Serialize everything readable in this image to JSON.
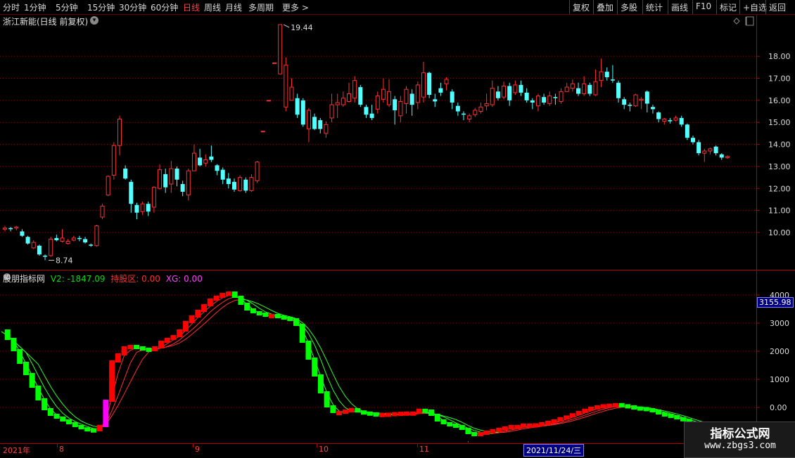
{
  "toolbar": {
    "periods": [
      "分时",
      "1分钟",
      "5分钟",
      "15分钟",
      "30分钟",
      "60分钟",
      "日线",
      "周线",
      "月线",
      "多周期",
      "更多 >"
    ],
    "active_period": "日线",
    "right_buttons": [
      "复权",
      "叠加",
      "多股",
      "统计",
      "画线",
      "F10",
      "标记",
      "+自选",
      "返回"
    ]
  },
  "main_chart": {
    "title": "浙江新能(日线 前复权)",
    "high_label": "19.44",
    "low_label": "8.74",
    "y_ticks": [
      "18.00",
      "17.00",
      "16.00",
      "15.00",
      "14.00",
      "13.00",
      "12.00",
      "11.00",
      "10.00"
    ]
  },
  "indicator": {
    "name": "股朋指标网",
    "v2_text": "V2: -1847.09",
    "hold_text": "持股区: 0.00",
    "xg_text": "XG: 0.00",
    "current_value": "3155.98",
    "y_ticks": [
      "4000",
      "3000",
      "2000",
      "1000",
      "0.00"
    ]
  },
  "date_axis": {
    "labels": [
      "2021年",
      "8",
      "9",
      "10",
      "11"
    ],
    "cursor_date": "2021/11/24/三"
  },
  "watermark": {
    "title": "指标公式网",
    "url": "www.zbgs3.com"
  },
  "colors": {
    "up": "#ff3030",
    "down": "#54ffff",
    "grid": "#8b0000",
    "bull_block": "#ff0000",
    "bear_block": "#00ff00",
    "signal_block": "#ff00ff"
  },
  "chart_data": {
    "type": "candlestick",
    "title": "浙江新能(日线 前复权)",
    "ylim": [
      8.5,
      19.6
    ],
    "candles": [
      [
        10.15,
        10.2,
        10.3,
        10.05
      ],
      [
        10.2,
        10.15,
        10.25,
        10.05
      ],
      [
        10.2,
        10.25,
        10.3,
        10.1
      ],
      [
        10.05,
        9.85,
        10.15,
        9.8
      ],
      [
        9.8,
        9.5,
        9.85,
        9.45
      ],
      [
        9.3,
        9.55,
        9.65,
        9.25
      ],
      [
        9.4,
        9.0,
        9.45,
        8.95
      ],
      [
        8.95,
        8.9,
        9.0,
        8.74
      ],
      [
        8.95,
        9.7,
        9.8,
        8.9
      ],
      [
        9.75,
        9.65,
        9.9,
        9.6
      ],
      [
        9.6,
        9.75,
        10.15,
        9.55
      ],
      [
        9.5,
        9.6,
        9.7,
        9.45
      ],
      [
        9.65,
        9.75,
        9.85,
        9.6
      ],
      [
        9.75,
        9.7,
        9.85,
        9.6
      ],
      [
        9.7,
        9.55,
        9.8,
        9.5
      ],
      [
        9.45,
        9.4,
        9.5,
        9.35
      ],
      [
        9.4,
        10.3,
        10.35,
        9.35
      ],
      [
        10.7,
        11.2,
        11.3,
        10.6
      ],
      [
        11.7,
        12.55,
        12.6,
        11.65
      ],
      [
        12.6,
        13.95,
        14.1,
        12.4
      ],
      [
        13.95,
        15.15,
        15.3,
        13.5
      ],
      [
        12.9,
        12.45,
        13.05,
        12.4
      ],
      [
        12.3,
        11.3,
        12.4,
        10.9
      ],
      [
        11.25,
        10.9,
        11.35,
        10.6
      ],
      [
        10.95,
        11.3,
        11.4,
        10.8
      ],
      [
        11.3,
        10.95,
        11.4,
        10.75
      ],
      [
        11.15,
        12.05,
        12.1,
        10.9
      ],
      [
        12.0,
        12.85,
        13.1,
        11.95
      ],
      [
        12.65,
        12.05,
        12.9,
        11.8
      ],
      [
        12.2,
        12.9,
        13.25,
        11.8
      ],
      [
        12.9,
        12.4,
        13.0,
        12.1
      ],
      [
        12.2,
        11.85,
        12.35,
        11.65
      ],
      [
        11.7,
        12.8,
        12.9,
        11.45
      ],
      [
        12.8,
        13.6,
        14.0,
        12.8
      ],
      [
        13.4,
        13.05,
        13.8,
        13.0
      ],
      [
        13.15,
        13.3,
        13.55,
        13.0
      ],
      [
        13.45,
        13.3,
        13.95,
        13.2
      ],
      [
        13.05,
        12.8,
        13.1,
        12.6
      ],
      [
        12.85,
        12.4,
        12.95,
        12.2
      ],
      [
        12.45,
        12.2,
        12.7,
        12.0
      ],
      [
        12.3,
        11.95,
        12.45,
        11.85
      ],
      [
        11.9,
        12.5,
        12.6,
        11.85
      ],
      [
        12.4,
        11.9,
        12.5,
        11.8
      ],
      [
        11.9,
        12.5,
        12.65,
        11.85
      ],
      [
        12.35,
        13.2,
        13.25,
        12.25
      ],
      [
        14.6,
        14.6,
        14.6,
        14.6
      ],
      [
        16.0,
        16.0,
        16.0,
        16.0
      ],
      [
        17.7,
        17.7,
        17.7,
        17.7
      ],
      [
        17.2,
        19.44,
        19.44,
        17.2
      ],
      [
        15.7,
        17.6,
        17.95,
        15.5
      ],
      [
        16.0,
        16.6,
        17.0,
        16.0
      ],
      [
        16.1,
        15.35,
        16.3,
        15.2
      ],
      [
        16.0,
        14.9,
        16.1,
        14.8
      ],
      [
        14.7,
        15.55,
        15.65,
        14.1
      ],
      [
        15.25,
        14.7,
        15.4,
        14.65
      ],
      [
        15.1,
        14.7,
        15.2,
        14.5
      ],
      [
        14.5,
        14.9,
        15.05,
        14.3
      ],
      [
        15.2,
        15.8,
        16.3,
        15.0
      ],
      [
        15.8,
        15.9,
        16.3,
        15.2
      ],
      [
        15.8,
        16.1,
        16.4,
        15.7
      ],
      [
        15.95,
        16.3,
        16.8,
        15.9
      ],
      [
        16.1,
        16.9,
        17.1,
        15.9
      ],
      [
        16.6,
        15.8,
        16.7,
        15.7
      ],
      [
        15.7,
        15.35,
        15.8,
        15.2
      ],
      [
        15.4,
        15.2,
        15.8,
        15.1
      ],
      [
        15.6,
        16.2,
        16.4,
        15.4
      ],
      [
        16.05,
        16.5,
        17.0,
        15.9
      ],
      [
        15.8,
        16.4,
        16.95,
        15.7
      ],
      [
        16.05,
        15.55,
        16.2,
        14.9
      ],
      [
        15.3,
        15.95,
        16.2,
        15.0
      ],
      [
        15.85,
        16.5,
        16.65,
        15.4
      ],
      [
        16.3,
        15.8,
        16.5,
        15.3
      ],
      [
        15.9,
        16.7,
        16.85,
        15.6
      ],
      [
        16.15,
        17.25,
        17.75,
        15.9
      ],
      [
        17.25,
        16.25,
        17.3,
        16.1
      ],
      [
        16.05,
        15.95,
        16.3,
        15.7
      ],
      [
        16.55,
        16.35,
        16.8,
        16.2
      ],
      [
        16.75,
        16.95,
        17.05,
        16.45
      ],
      [
        16.4,
        15.9,
        16.5,
        15.6
      ],
      [
        15.75,
        15.5,
        15.9,
        15.3
      ],
      [
        15.4,
        15.35,
        15.5,
        15.1
      ],
      [
        15.15,
        15.3,
        15.4,
        15.0
      ],
      [
        15.35,
        15.55,
        15.65,
        15.25
      ],
      [
        15.5,
        15.7,
        15.9,
        15.4
      ],
      [
        15.75,
        15.85,
        16.3,
        15.55
      ],
      [
        15.8,
        16.55,
        16.9,
        15.7
      ],
      [
        16.4,
        16.1,
        16.65,
        16.0
      ],
      [
        16.15,
        16.65,
        16.85,
        16.05
      ],
      [
        16.65,
        16.0,
        16.8,
        15.75
      ],
      [
        16.35,
        16.7,
        16.9,
        16.25
      ],
      [
        16.7,
        16.35,
        16.9,
        16.2
      ],
      [
        16.35,
        16.0,
        16.55,
        15.9
      ],
      [
        16.0,
        15.9,
        16.1,
        15.6
      ],
      [
        15.75,
        16.2,
        16.3,
        15.5
      ],
      [
        16.15,
        15.9,
        16.3,
        15.8
      ],
      [
        15.85,
        16.2,
        16.4,
        15.75
      ],
      [
        16.15,
        16.1,
        16.3,
        15.8
      ],
      [
        15.95,
        16.4,
        16.55,
        15.85
      ],
      [
        16.4,
        16.6,
        16.8,
        16.4
      ],
      [
        16.55,
        16.75,
        16.95,
        16.4
      ],
      [
        16.55,
        16.3,
        16.8,
        16.2
      ],
      [
        16.3,
        16.75,
        17.1,
        16.2
      ],
      [
        16.7,
        16.3,
        16.8,
        16.2
      ],
      [
        16.25,
        16.85,
        17.4,
        16.2
      ],
      [
        16.9,
        17.3,
        17.9,
        16.6
      ],
      [
        17.3,
        17.05,
        17.5,
        16.9
      ],
      [
        16.95,
        16.9,
        17.6,
        16.8
      ],
      [
        16.8,
        16.1,
        16.9,
        15.9
      ],
      [
        16.05,
        15.8,
        16.15,
        15.6
      ],
      [
        15.8,
        15.75,
        15.9,
        15.5
      ],
      [
        15.75,
        16.25,
        16.3,
        15.7
      ],
      [
        16.0,
        16.05,
        16.15,
        15.6
      ],
      [
        16.4,
        15.85,
        16.45,
        15.45
      ],
      [
        15.7,
        15.6,
        15.8,
        15.4
      ],
      [
        15.45,
        15.15,
        15.5,
        15.0
      ],
      [
        15.05,
        15.15,
        15.2,
        14.9
      ],
      [
        15.1,
        15.05,
        15.2,
        14.95
      ],
      [
        15.1,
        15.2,
        15.3,
        15.05
      ],
      [
        15.2,
        14.9,
        15.3,
        14.8
      ],
      [
        14.9,
        14.3,
        14.95,
        14.2
      ],
      [
        14.3,
        14.1,
        14.4,
        14.0
      ],
      [
        14.1,
        13.6,
        14.2,
        13.5
      ],
      [
        13.6,
        13.7,
        13.8,
        13.2
      ],
      [
        13.7,
        13.8,
        13.85,
        13.55
      ],
      [
        13.9,
        13.6,
        13.95,
        13.5
      ],
      [
        13.55,
        13.4,
        13.6,
        13.3
      ],
      [
        13.4,
        13.45,
        13.5,
        13.35
      ]
    ]
  },
  "indicator_data": {
    "ylim": [
      -1200,
      4500
    ],
    "values": [
      2700,
      2400,
      2000,
      1550,
      1150,
      700,
      250,
      -100,
      -300,
      -400,
      -500,
      -600,
      -700,
      -780,
      -820,
      -850,
      -700,
      200,
      1600,
      1850,
      2100,
      2150,
      2100,
      2050,
      2000,
      2100,
      2300,
      2400,
      2500,
      2700,
      3000,
      3200,
      3400,
      3600,
      3800,
      3900,
      4000,
      4050,
      3900,
      3650,
      3450,
      3350,
      3300,
      3250,
      3250,
      3200,
      3150,
      3100,
      2900,
      2300,
      1700,
      1100,
      500,
      0,
      -200,
      -200,
      -150,
      -100,
      -180,
      -220,
      -250,
      -280,
      -270,
      -260,
      -240,
      -230,
      -220,
      -220,
      -120,
      -150,
      -300,
      -500,
      -600,
      -650,
      -700,
      -800,
      -950,
      -1000,
      -950,
      -900,
      -850,
      -800,
      -750,
      -700,
      -700,
      -650,
      -650,
      -640,
      -600,
      -550,
      -500,
      -420,
      -360,
      -280,
      -200,
      -120,
      -50,
      0,
      40,
      60,
      80,
      40,
      0,
      -40,
      -60,
      -100,
      -150,
      -250,
      -300,
      -350,
      -420,
      -480,
      -580,
      -650,
      -720,
      -800,
      -900,
      -1000,
      -1100,
      -1200,
      -1300,
      -1400,
      -1500
    ]
  }
}
